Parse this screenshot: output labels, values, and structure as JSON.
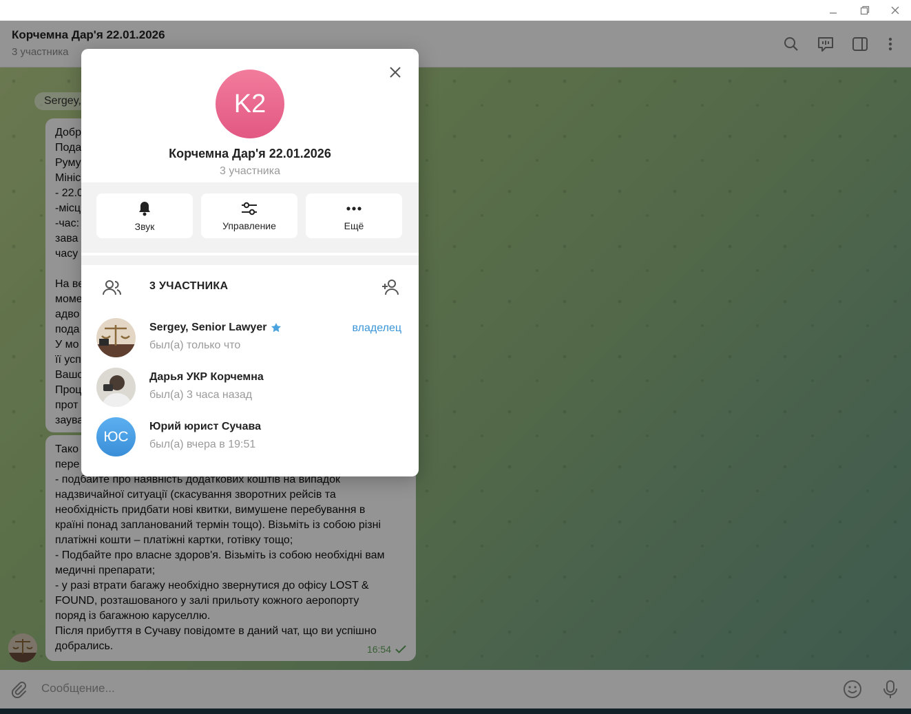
{
  "window": {
    "minimize_icon": "minimize-icon",
    "restore_icon": "restore-icon",
    "close_icon": "close-icon"
  },
  "header": {
    "title": "Корчемна Дар'я 22.01.2026",
    "subtitle": "3 участника"
  },
  "chat": {
    "sender": "Sergey,",
    "bubble1_lines": [
      "Добр",
      "Пода",
      "Руму",
      "Мініс",
      "- 22.0",
      "-місц",
      "-час:",
      "зава",
      "часу",
      "",
      "На ве",
      "моме",
      "адво",
      "пода",
      "У мо",
      "її усп",
      "Вашо",
      "Проц",
      "прот",
      "заува"
    ],
    "bubble2_lines": [
      "Тако",
      "пере",
      "- подбайте про наявність додаткових коштів на випадок",
      "надзвичайної ситуації (скасування зворотних рейсів та",
      "необхідність придбати нові квитки, вимушене перебування в",
      "країні понад запланований термін тощо). Візьміть із собою різні",
      "платіжні кошти – платіжні картки, готівку тощо;",
      "- Подбайте про власне здоров'я. Візьміть із собою необхідні вам",
      "медичні препарати;",
      "- у разі втрати багажу необхідно звернутися до офісу LOST &",
      "FOUND, розташованого у залі прильоту кожного аеропорту",
      "поряд із багажною каруселлю.",
      "Після прибуття в Сучаву повідомте в даний чат, що ви успішно",
      "добрались."
    ],
    "time": "16:54"
  },
  "composer": {
    "placeholder": "Сообщение..."
  },
  "modal": {
    "avatar_initials": "K2",
    "title": "Корчемна Дар'я 22.01.2026",
    "subtitle": "3 участника",
    "actions": [
      {
        "label": "Звук",
        "icon": "bell-icon"
      },
      {
        "label": "Управление",
        "icon": "sliders-icon"
      },
      {
        "label": "Ещё",
        "icon": "more-icon"
      }
    ],
    "members_title": "3 УЧАСТНИКА",
    "members": [
      {
        "name": "Sergey, Senior Lawyer",
        "status": "был(а) только что",
        "role": "владелец"
      },
      {
        "name": "Дарья УКР Корчемна",
        "status": "был(а) 3 часа назад"
      },
      {
        "name": "Юрий юрист Сучава",
        "status": "был(а) вчера в 19:51",
        "initials": "ЮС"
      }
    ]
  },
  "colors": {
    "accent": "#3a95d8",
    "avatar_pink": "#e9678f",
    "avatar_blue": "#4a9fe6",
    "check_green": "#5fa35a"
  }
}
